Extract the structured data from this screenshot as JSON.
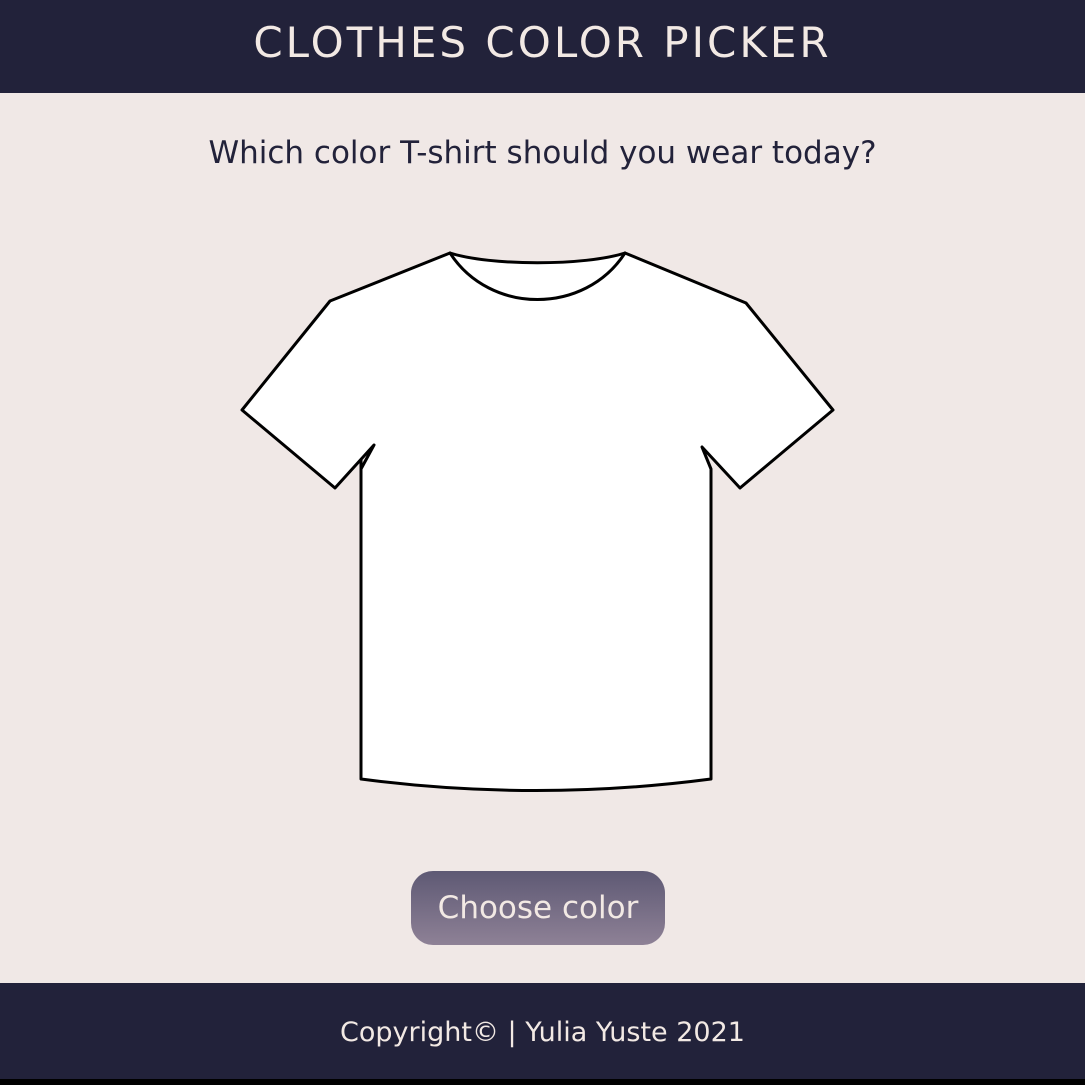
{
  "header": {
    "title": "CLOTHES COLOR PICKER"
  },
  "main": {
    "question": "Which color T-shirt should you wear today?",
    "shirt": {
      "icon": "tshirt-icon",
      "fill_color": "#ffffff",
      "outline_color": "#000000"
    },
    "choose_button_label": "Choose color"
  },
  "footer": {
    "copyright_text": "Copyright© | Yulia Yuste 2021"
  },
  "colors": {
    "header_bg": "#22223a",
    "page_bg": "#f0e8e6",
    "text_light": "#f2e9e4",
    "text_dark": "#22223a",
    "button_gradient_top": "#5e5974",
    "button_gradient_bottom": "#8e8196"
  }
}
